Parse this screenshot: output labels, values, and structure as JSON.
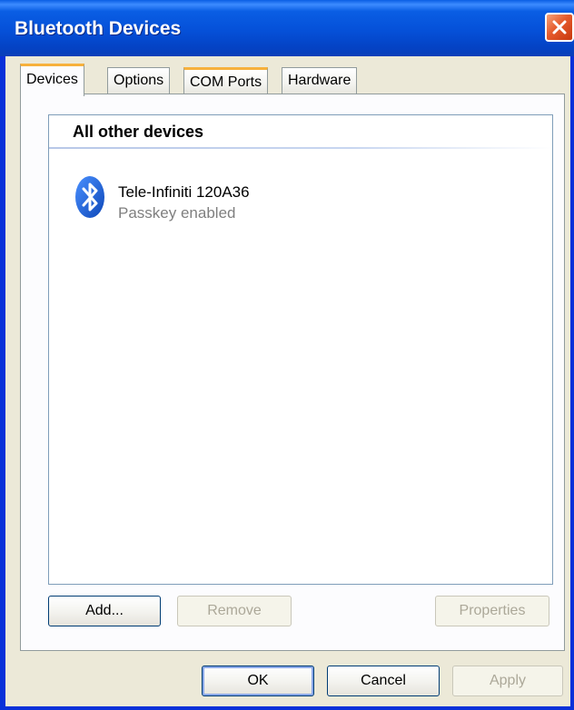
{
  "window": {
    "title": "Bluetooth Devices"
  },
  "tabs": [
    {
      "label": "Devices"
    },
    {
      "label": "Options"
    },
    {
      "label": "COM Ports"
    },
    {
      "label": "Hardware"
    }
  ],
  "devices_panel": {
    "group_header": "All other devices",
    "devices": [
      {
        "name": "Tele-Infiniti 120A36",
        "status": "Passkey enabled",
        "icon": "bluetooth-icon"
      }
    ],
    "buttons": {
      "add": "Add...",
      "remove": "Remove",
      "properties": "Properties"
    }
  },
  "dialog_buttons": {
    "ok": "OK",
    "cancel": "Cancel",
    "apply": "Apply"
  },
  "colors": {
    "titlebar": "#0a5ee4",
    "close": "#e55a2b",
    "tab_highlight": "#f7b13c",
    "bluetooth": "#1565d8"
  }
}
